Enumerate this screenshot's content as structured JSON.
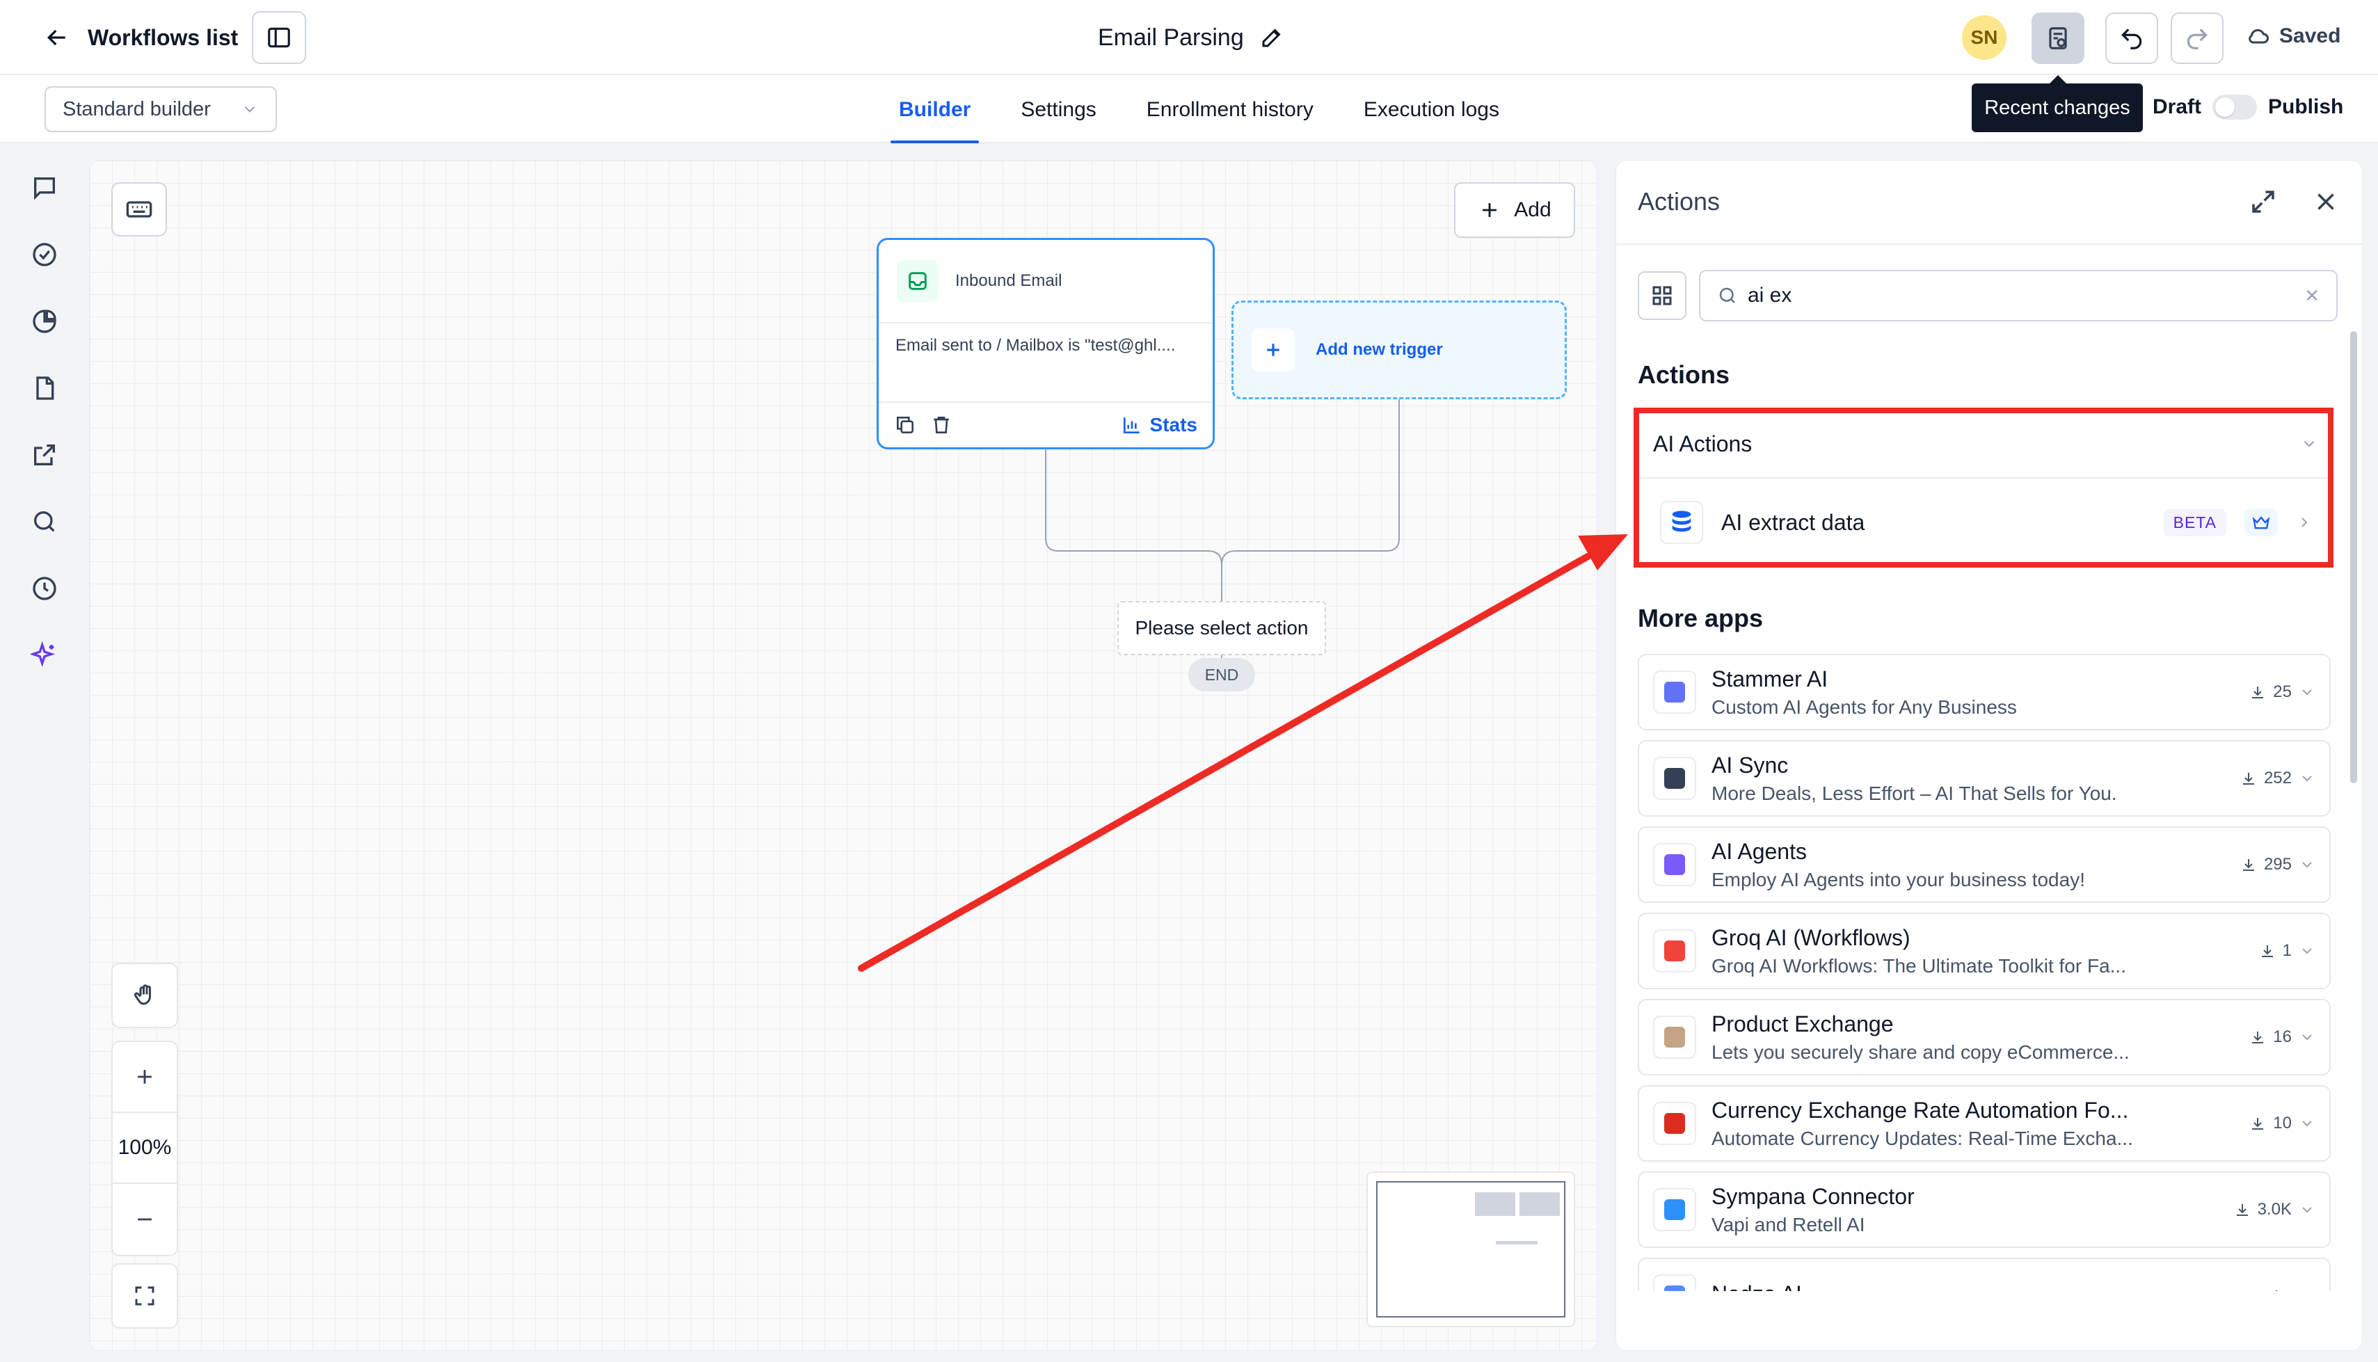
{
  "header": {
    "back_label": "Workflows list",
    "workflow_title": "Email Parsing",
    "avatar_initials": "SN",
    "saved_label": "Saved"
  },
  "subbar": {
    "builder_select": "Standard builder",
    "tabs": [
      {
        "label": "Builder",
        "active": true
      },
      {
        "label": "Settings",
        "active": false
      },
      {
        "label": "Enrollment history",
        "active": false
      },
      {
        "label": "Execution logs",
        "active": false
      }
    ],
    "tooltip": "Recent changes",
    "draft_label": "Draft",
    "publish_label": "Publish"
  },
  "canvas": {
    "add_label": "Add",
    "trigger": {
      "title": "Inbound Email",
      "condition": "Email sent to / Mailbox is \"test@ghl....",
      "stats_label": "Stats"
    },
    "new_trigger_label": "Add new trigger",
    "select_action_label": "Please select action",
    "end_label": "END",
    "zoom_level": "100%"
  },
  "panel": {
    "title": "Actions",
    "search_value": "ai ex",
    "actions_heading": "Actions",
    "ai_group_label": "AI Actions",
    "ai_item_label": "AI extract data",
    "ai_item_badge": "BETA",
    "more_apps_heading": "More apps",
    "apps": [
      {
        "name": "Stammer AI",
        "desc": "Custom AI Agents for Any Business",
        "count": "25",
        "color": "#6172f3"
      },
      {
        "name": "AI Sync",
        "desc": "More Deals, Less Effort – AI That Sells for You.",
        "count": "252",
        "color": "#344054"
      },
      {
        "name": "AI Agents",
        "desc": "Employ AI Agents into your business today!",
        "count": "295",
        "color": "#7a5af8"
      },
      {
        "name": "Groq AI (Workflows)",
        "desc": "Groq AI Workflows: The Ultimate Toolkit for Fa...",
        "count": "1",
        "color": "#f04438"
      },
      {
        "name": "Product Exchange",
        "desc": "Lets you securely share and copy eCommerce...",
        "count": "16",
        "color": "#c4a484"
      },
      {
        "name": "Currency Exchange Rate Automation Fo...",
        "desc": "Automate Currency Updates: Real-Time Excha...",
        "count": "10",
        "color": "#d92d20"
      },
      {
        "name": "Sympana Connector",
        "desc": "Vapi and Retell AI",
        "count": "3.0K",
        "color": "#2e90fa"
      },
      {
        "name": "Nedzo AI",
        "desc": "",
        "count": "",
        "color": "#528bff"
      }
    ]
  },
  "colors": {
    "accent": "#155eef",
    "highlight_red": "#ee2a24"
  }
}
